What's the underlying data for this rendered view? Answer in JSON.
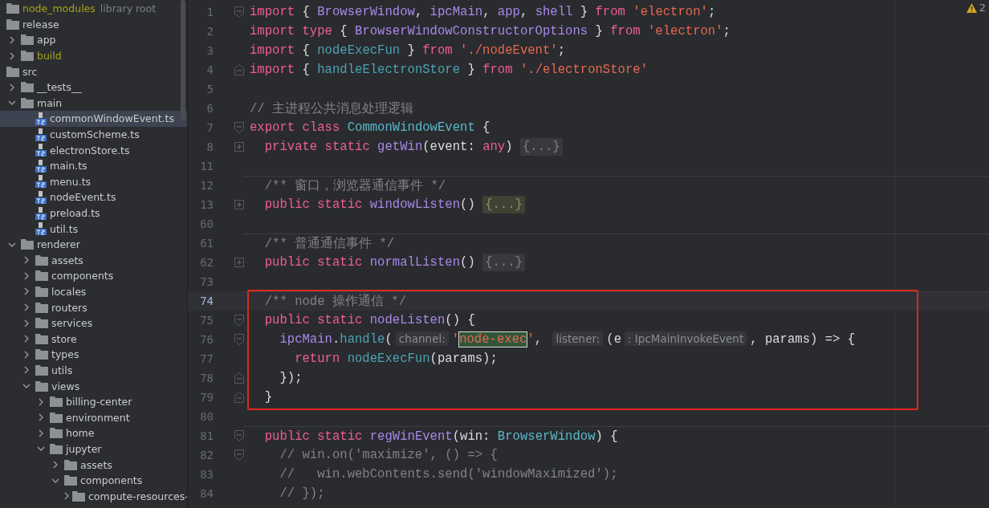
{
  "project_tree": [
    {
      "name": "node_modules",
      "kind": "folder",
      "excluded": true,
      "selected": false,
      "note": "library root"
    },
    {
      "name": "release",
      "kind": "folder",
      "selected": false,
      "children": [
        {
          "name": "app",
          "kind": "folder",
          "expanded": false,
          "excluded": false,
          "selected": false
        },
        {
          "name": "build",
          "kind": "folder",
          "expanded": false,
          "excluded": true,
          "selected": false
        }
      ]
    },
    {
      "name": "src",
      "kind": "folder",
      "selected": false,
      "children": [
        {
          "name": "__tests__",
          "kind": "folder",
          "expanded": false,
          "selected": false
        },
        {
          "name": "main",
          "kind": "folder",
          "expanded": true,
          "selected": false,
          "children": [
            {
              "name": "commonWindowEvent.ts",
              "kind": "ts",
              "selected": true
            },
            {
              "name": "customScheme.ts",
              "kind": "ts",
              "selected": false
            },
            {
              "name": "electronStore.ts",
              "kind": "ts",
              "selected": false
            },
            {
              "name": "main.ts",
              "kind": "ts",
              "selected": false
            },
            {
              "name": "menu.ts",
              "kind": "ts",
              "selected": false
            },
            {
              "name": "nodeEvent.ts",
              "kind": "ts",
              "selected": false
            },
            {
              "name": "preload.ts",
              "kind": "ts",
              "selected": false
            },
            {
              "name": "util.ts",
              "kind": "ts",
              "selected": false
            }
          ]
        },
        {
          "name": "renderer",
          "kind": "folder",
          "expanded": true,
          "selected": false,
          "children": [
            {
              "name": "assets",
              "kind": "folder",
              "expanded": false,
              "selected": false
            },
            {
              "name": "components",
              "kind": "folder",
              "expanded": false,
              "selected": false
            },
            {
              "name": "locales",
              "kind": "folder",
              "expanded": false,
              "selected": false
            },
            {
              "name": "routers",
              "kind": "folder",
              "expanded": false,
              "selected": false
            },
            {
              "name": "services",
              "kind": "folder",
              "expanded": false,
              "selected": false
            },
            {
              "name": "store",
              "kind": "folder",
              "expanded": false,
              "selected": false
            },
            {
              "name": "types",
              "kind": "folder",
              "expanded": false,
              "selected": false
            },
            {
              "name": "utils",
              "kind": "folder",
              "expanded": false,
              "selected": false
            },
            {
              "name": "views",
              "kind": "folder",
              "expanded": true,
              "selected": false,
              "children": [
                {
                  "name": "billing-center",
                  "kind": "folder",
                  "expanded": false,
                  "selected": false
                },
                {
                  "name": "environment",
                  "kind": "folder",
                  "expanded": false,
                  "selected": false
                },
                {
                  "name": "home",
                  "kind": "folder",
                  "expanded": false,
                  "selected": false
                },
                {
                  "name": "jupyter",
                  "kind": "folder",
                  "expanded": true,
                  "selected": false,
                  "children": [
                    {
                      "name": "assets",
                      "kind": "folder",
                      "expanded": false,
                      "selected": false
                    },
                    {
                      "name": "components",
                      "kind": "folder",
                      "expanded": true,
                      "selected": false,
                      "children": [
                        {
                          "name": "compute-resources-",
                          "kind": "folder",
                          "expanded": false,
                          "selected": false
                        }
                      ]
                    }
                  ]
                }
              ]
            }
          ]
        }
      ]
    }
  ],
  "editor": {
    "warning_count": "2",
    "blocks": [
      {
        "boxed": false,
        "lines": [
          {
            "number": "1",
            "fold_start": true,
            "tokens": [
              {
                "text": "import",
                "kind": "keyword"
              },
              {
                "text": " { ",
                "kind": "plain"
              },
              {
                "text": "BrowserWindow",
                "kind": "function"
              },
              {
                "text": ", ",
                "kind": "plain"
              },
              {
                "text": "ipcMain",
                "kind": "function"
              },
              {
                "text": ", ",
                "kind": "plain"
              },
              {
                "text": "app",
                "kind": "function"
              },
              {
                "text": ", ",
                "kind": "plain"
              },
              {
                "text": "shell",
                "kind": "function"
              },
              {
                "text": " } ",
                "kind": "plain"
              },
              {
                "text": "from",
                "kind": "keyword"
              },
              {
                "text": " 'electron'",
                "kind": "string"
              },
              {
                "text": ";",
                "kind": "plain"
              }
            ]
          },
          {
            "number": "2",
            "tokens": [
              {
                "text": "import",
                "kind": "keyword"
              },
              {
                "text": " type",
                "kind": "keyword"
              },
              {
                "text": " { ",
                "kind": "plain"
              },
              {
                "text": "BrowserWindowConstructorOptions",
                "kind": "function"
              },
              {
                "text": " } ",
                "kind": "plain"
              },
              {
                "text": "from",
                "kind": "keyword"
              },
              {
                "text": " 'electron'",
                "kind": "string"
              },
              {
                "text": ";",
                "kind": "plain"
              }
            ]
          },
          {
            "number": "3",
            "tokens": [
              {
                "text": "import",
                "kind": "keyword"
              },
              {
                "text": " { ",
                "kind": "plain"
              },
              {
                "text": "nodeExecFun",
                "kind": "imported"
              },
              {
                "text": " } ",
                "kind": "plain"
              },
              {
                "text": "from",
                "kind": "keyword"
              },
              {
                "text": " './nodeEvent'",
                "kind": "string"
              },
              {
                "text": ";",
                "kind": "plain"
              }
            ]
          },
          {
            "number": "4",
            "fold_end": true,
            "tokens": [
              {
                "text": "import",
                "kind": "keyword"
              },
              {
                "text": " { ",
                "kind": "plain"
              },
              {
                "text": "handleElectronStore",
                "kind": "imported"
              },
              {
                "text": " } ",
                "kind": "plain"
              },
              {
                "text": "from",
                "kind": "keyword"
              },
              {
                "text": " './electronStore'",
                "kind": "string"
              }
            ]
          },
          {
            "number": "5"
          },
          {
            "number": "6",
            "tokens": [
              {
                "text": "// 主进程公共消息处理逻辑",
                "kind": "comment"
              }
            ]
          },
          {
            "number": "7",
            "fold_start": true,
            "tokens": [
              {
                "text": "export",
                "kind": "keyword"
              },
              {
                "text": " class",
                "kind": "keyword"
              },
              {
                "text": " CommonWindowEvent",
                "kind": "class"
              },
              {
                "text": " {",
                "kind": "plain"
              }
            ]
          },
          {
            "number": "8",
            "collapsed": true,
            "tokens": [
              {
                "text": "  private",
                "kind": "keyword"
              },
              {
                "text": " static",
                "kind": "keyword"
              },
              {
                "text": " getWin",
                "kind": "function"
              },
              {
                "text": "(event: ",
                "kind": "plain"
              },
              {
                "text": "any",
                "kind": "keyword"
              },
              {
                "text": ") ",
                "kind": "plain"
              },
              {
                "text": "{...}",
                "kind": "folded"
              }
            ]
          },
          {
            "number": "11"
          },
          {
            "number": "12",
            "separator": true,
            "tokens": [
              {
                "text": "  /** 窗口，浏览器通信事件 */",
                "kind": "comment"
              }
            ]
          },
          {
            "number": "13",
            "collapsed": true,
            "tokens": [
              {
                "text": "  public",
                "kind": "keyword"
              },
              {
                "text": " static",
                "kind": "keyword"
              },
              {
                "text": " windowListen",
                "kind": "function"
              },
              {
                "text": "() ",
                "kind": "plain"
              },
              {
                "text": "{...}",
                "kind": "folded-marked"
              }
            ]
          },
          {
            "number": "60"
          },
          {
            "number": "61",
            "separator": true,
            "tokens": [
              {
                "text": "  /** 普通通信事件 */",
                "kind": "comment"
              }
            ]
          },
          {
            "number": "62",
            "collapsed": true,
            "tokens": [
              {
                "text": "  public",
                "kind": "keyword"
              },
              {
                "text": " static",
                "kind": "keyword"
              },
              {
                "text": " normalListen",
                "kind": "function"
              },
              {
                "text": "() ",
                "kind": "plain"
              },
              {
                "text": "{...}",
                "kind": "folded"
              }
            ]
          },
          {
            "number": "73"
          }
        ]
      },
      {
        "boxed": true,
        "lines": [
          {
            "number": "74",
            "current": true,
            "separator": true,
            "tokens": [
              {
                "text": "  /** node 操作通信 */",
                "kind": "comment"
              }
            ]
          },
          {
            "number": "75",
            "fold_start": true,
            "tokens": [
              {
                "text": "  public",
                "kind": "keyword"
              },
              {
                "text": " static",
                "kind": "keyword"
              },
              {
                "text": " nodeListen",
                "kind": "function"
              },
              {
                "text": "() {",
                "kind": "plain"
              }
            ]
          },
          {
            "number": "76",
            "fold_start": true,
            "tokens": [
              {
                "text": "    ipcMain",
                "kind": "function"
              },
              {
                "text": ".",
                "kind": "plain"
              },
              {
                "text": "handle",
                "kind": "imported"
              },
              {
                "text": "(",
                "kind": "plain"
              },
              {
                "text": "channel:",
                "kind": "hint"
              },
              {
                "text": "'",
                "kind": "string"
              },
              {
                "text": "node-exec",
                "kind": "match"
              },
              {
                "text": "'",
                "kind": "string"
              },
              {
                "text": ", ",
                "kind": "plain"
              },
              {
                "text": "listener:",
                "kind": "hint"
              },
              {
                "text": "(e",
                "kind": "plain"
              },
              {
                "text": ": IpcMainInvokeEvent",
                "kind": "hint"
              },
              {
                "text": ", params) => {",
                "kind": "plain"
              }
            ]
          },
          {
            "number": "77",
            "tokens": [
              {
                "text": "      return",
                "kind": "keyword"
              },
              {
                "text": " nodeExecFun",
                "kind": "imported"
              },
              {
                "text": "(params);",
                "kind": "plain"
              }
            ]
          },
          {
            "number": "78",
            "fold_end": true,
            "tokens": [
              {
                "text": "    });",
                "kind": "plain"
              }
            ]
          },
          {
            "number": "79",
            "fold_end": true,
            "tokens": [
              {
                "text": "  }",
                "kind": "plain"
              }
            ]
          }
        ]
      },
      {
        "boxed": false,
        "lines": [
          {
            "number": "80"
          },
          {
            "number": "81",
            "fold_start": true,
            "separator": true,
            "tokens": [
              {
                "text": "  public",
                "kind": "keyword"
              },
              {
                "text": " static",
                "kind": "keyword"
              },
              {
                "text": " regWinEvent",
                "kind": "function"
              },
              {
                "text": "(win: ",
                "kind": "plain"
              },
              {
                "text": "BrowserWindow",
                "kind": "class"
              },
              {
                "text": ") {",
                "kind": "plain"
              }
            ]
          },
          {
            "number": "82",
            "fold_start": true,
            "tokens": [
              {
                "text": "    // win.on('maximize', () => {",
                "kind": "comment"
              }
            ]
          },
          {
            "number": "83",
            "tokens": [
              {
                "text": "    //   win.webContents.send('windowMaximized');",
                "kind": "comment"
              }
            ]
          },
          {
            "number": "84",
            "tokens": [
              {
                "text": "    // });",
                "kind": "comment"
              }
            ]
          }
        ]
      }
    ]
  }
}
